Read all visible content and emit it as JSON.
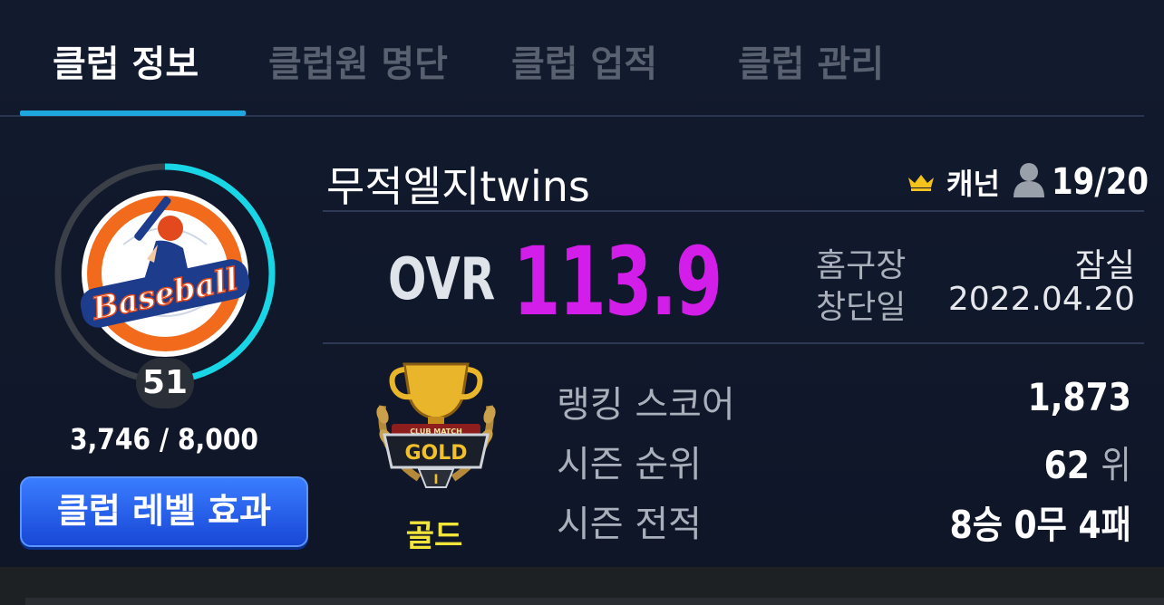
{
  "tabs": [
    {
      "label": "클럽 정보",
      "active": true
    },
    {
      "label": "클럽원 명단",
      "active": false
    },
    {
      "label": "클럽 업적",
      "active": false
    },
    {
      "label": "클럽 관리",
      "active": false
    }
  ],
  "club": {
    "emblem_text": "Baseball",
    "level": "51",
    "exp": "3,746 / 8,000",
    "exp_fraction": 0.468,
    "level_effect_button": "클럽 레벨 효과",
    "name": "무적엘지twins",
    "captain": "캐넌",
    "members": "19/20",
    "ovr_label": "OVR",
    "ovr_value": "113.9"
  },
  "info": {
    "home_label": "홈구장",
    "home_value": "잠실",
    "founded_label": "창단일",
    "founded_value": "2022.04.20"
  },
  "tier": {
    "badge_top": "CLUB MATCH",
    "badge_text": "GOLD",
    "badge_sub": "I",
    "name": "골드"
  },
  "stats": {
    "ranking_label": "랭킹 스코어",
    "ranking_value": "1,873",
    "season_rank_label": "시즌 순위",
    "season_rank_value": "62",
    "season_rank_unit": "위",
    "season_record_label": "시즌 전적",
    "season_record_value": "8승 0무 4패"
  },
  "colors": {
    "accent": "#1ea6de",
    "ovr": "#d21ee8",
    "tier": "#f3e43a",
    "exp_ring": "#19d6e6"
  }
}
